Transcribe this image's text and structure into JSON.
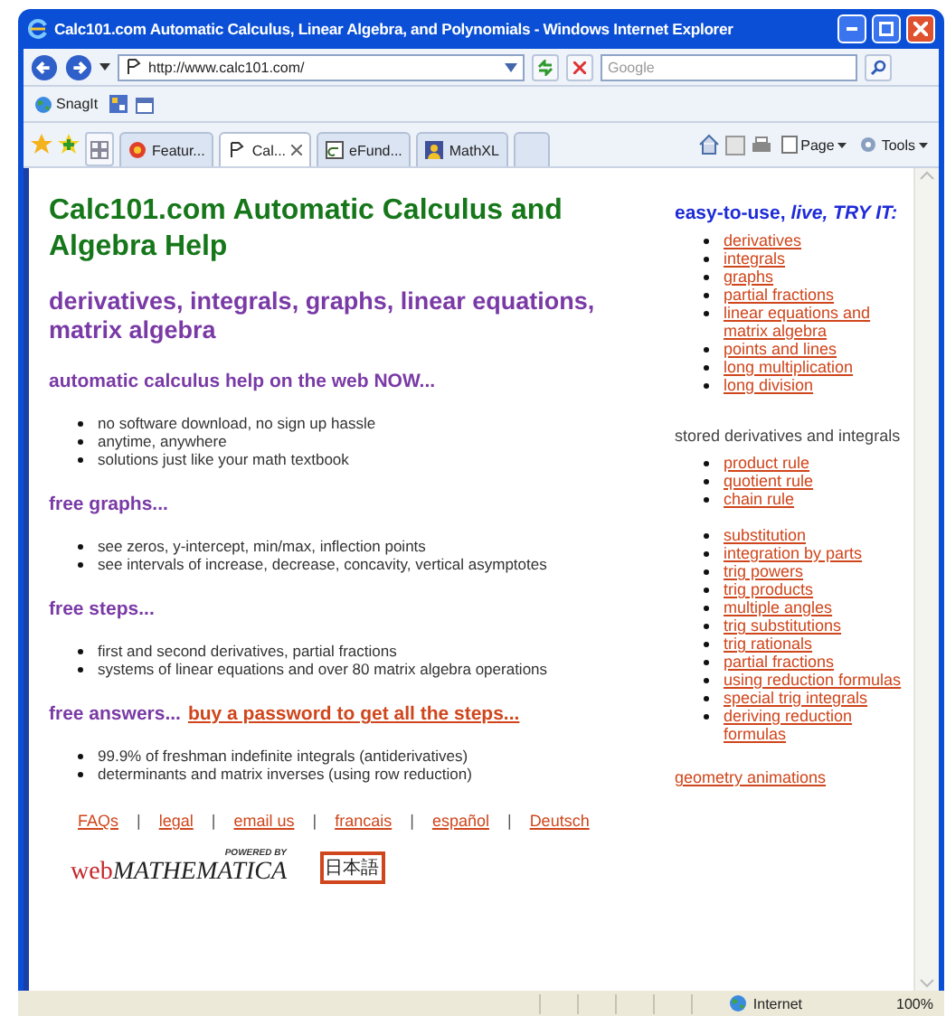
{
  "window": {
    "title": "Calc101.com Automatic Calculus, Linear Algebra, and Polynomials - Windows Internet Explorer"
  },
  "address": {
    "url": "http://www.calc101.com/"
  },
  "search": {
    "placeholder": "Google"
  },
  "links_bar": [
    "SnagIt"
  ],
  "tabs": [
    {
      "label": "Featur...",
      "selected": false
    },
    {
      "label": "Cal...",
      "selected": true
    },
    {
      "label": "eFund...",
      "selected": false
    },
    {
      "label": "MathXL",
      "selected": false
    }
  ],
  "commands": [
    "Page",
    "Tools"
  ],
  "page": {
    "heading": "Calc101.com Automatic Calculus and Algebra Help",
    "subheading": "derivatives, integrals, graphs, linear equations, matrix algebra",
    "sections": [
      {
        "heading": "automatic calculus help on the web NOW...",
        "bullets": [
          "no software download, no sign up hassle",
          "anytime, anywhere",
          "solutions just like your math textbook"
        ]
      },
      {
        "heading": "free graphs...",
        "bullets": [
          "see zeros, y-intercept, min/max, inflection points",
          "see intervals of increase, decrease, concavity, vertical asymptotes"
        ]
      },
      {
        "heading": "free steps...",
        "bullets": [
          "first and second derivatives, partial fractions",
          "systems of linear equations and over 80 matrix algebra operations"
        ]
      },
      {
        "heading": "free answers...",
        "link": "buy a password to get all the steps...",
        "bullets": [
          "99.9% of freshman indefinite integrals (antiderivatives)",
          "determinants and matrix inverses (using row reduction)"
        ]
      }
    ],
    "footer": [
      {
        "kind": "link",
        "text": "FAQs"
      },
      {
        "kind": "separator",
        "text": "|"
      },
      {
        "kind": "link",
        "text": "legal"
      },
      {
        "kind": "separator",
        "text": "|"
      },
      {
        "kind": "link",
        "text": "email us"
      },
      {
        "kind": "separator",
        "text": "|"
      },
      {
        "kind": "link",
        "text": "francais"
      },
      {
        "kind": "separator",
        "text": "|"
      },
      {
        "kind": "link",
        "text": "español"
      },
      {
        "kind": "separator",
        "text": "|"
      },
      {
        "kind": "link",
        "text": "Deutsch"
      }
    ],
    "logo": {
      "powered": "POWERED BY",
      "web": "web",
      "name": "MATHEMATICA"
    },
    "language_button": "日本語"
  },
  "sidebar": {
    "title": "easy-to-use, *live, TRY IT:*",
    "groups": [
      {
        "links": [
          "derivatives",
          "integrals",
          "graphs",
          "partial fractions",
          "linear equations and matrix algebra",
          "points and lines",
          "long multiplication",
          "long division"
        ]
      },
      {
        "heading": "stored derivatives and integrals",
        "links": [
          "product rule",
          "quotient rule",
          "chain rule"
        ]
      },
      {
        "links": [
          "substitution",
          "integration by parts",
          "trig powers",
          "trig products",
          "multiple angles",
          "trig substitutions",
          "trig rationals",
          "partial fractions",
          "using reduction formulas",
          "special trig integrals",
          "deriving reduction formulas"
        ]
      }
    ],
    "extra_link": "geometry animations"
  },
  "status_bar": {
    "zone": "Internet",
    "zoom": "100%"
  }
}
